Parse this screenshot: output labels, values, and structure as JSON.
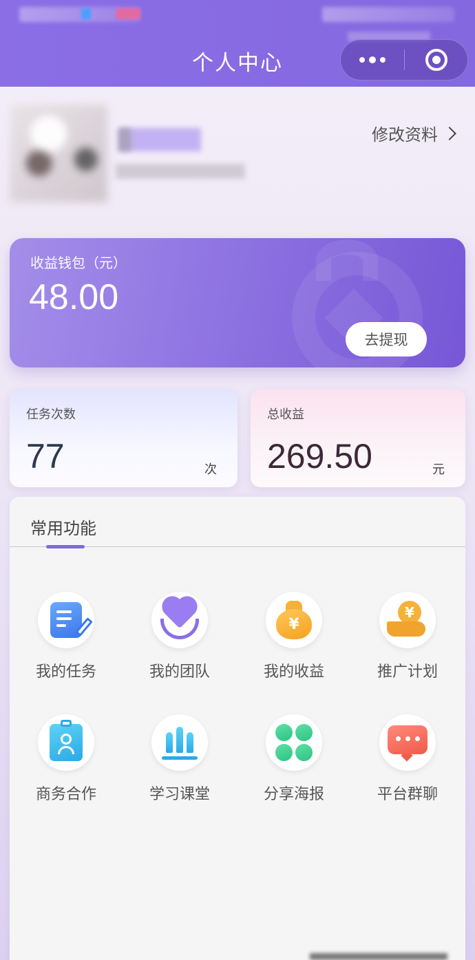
{
  "header": {
    "title": "个人中心",
    "accent_color": "#8b6ee6"
  },
  "profile": {
    "edit_label": "修改资料"
  },
  "wallet": {
    "label": "收益钱包（元）",
    "amount": "48.00",
    "withdraw_label": "去提现"
  },
  "stats": {
    "tasks": {
      "label": "任务次数",
      "value": "77",
      "unit": "次"
    },
    "income": {
      "label": "总收益",
      "value": "269.50",
      "unit": "元"
    }
  },
  "functions": {
    "title": "常用功能",
    "items": [
      {
        "label": "我的任务",
        "icon": "task-icon"
      },
      {
        "label": "我的团队",
        "icon": "team-heart-icon"
      },
      {
        "label": "我的收益",
        "icon": "money-bag-icon"
      },
      {
        "label": "推广计划",
        "icon": "coin-hand-icon"
      },
      {
        "label": "商务合作",
        "icon": "business-badge-icon"
      },
      {
        "label": "学习课堂",
        "icon": "study-bars-icon"
      },
      {
        "label": "分享海报",
        "icon": "clover-share-icon"
      },
      {
        "label": "平台群聊",
        "icon": "chat-bubble-icon"
      }
    ]
  }
}
